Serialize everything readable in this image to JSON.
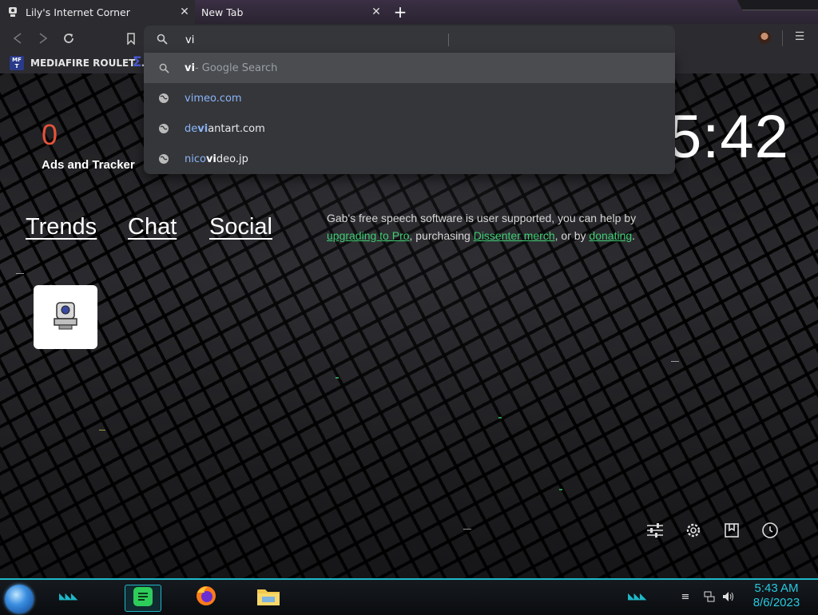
{
  "tabs": [
    {
      "title": "Lily's Internet Corner",
      "icon": "webcam-favicon-icon",
      "active": true
    },
    {
      "title": "New Tab",
      "active": false
    }
  ],
  "omnibox": {
    "value": "vi",
    "suggestions": [
      {
        "prefix": "vi",
        "rest": " - Google Search",
        "type": "search",
        "selected": true
      },
      {
        "before": "",
        "match": "vi",
        "after": "meo.com",
        "type": "url"
      },
      {
        "before": "de",
        "match": "vi",
        "after": "antart.com",
        "type": "url"
      },
      {
        "before": "nico",
        "match": "vi",
        "after": "deo.jp",
        "type": "url"
      }
    ]
  },
  "bookmarks": [
    {
      "label": "MEDIAFIRE ROULET...",
      "icon_text": "MF T"
    }
  ],
  "page": {
    "ads_count": "0",
    "ads_label": "Ads and Tracker",
    "clock": "5:42",
    "nav": [
      "Trends",
      "Chat",
      "Social"
    ],
    "gab": {
      "t1": "Gab's free speech software is user supported, you can help by ",
      "link1": "upgrading to Pro",
      "t2": ", purchasing ",
      "link2": "Dissenter merch",
      "t3": ", or by ",
      "link3": "donating",
      "t4": "."
    }
  },
  "taskbar": {
    "time": "5:43 AM",
    "date": "8/6/2023"
  },
  "colors": {
    "accent": "#1fb8c9",
    "ads_count": "#e7533a",
    "link_green": "#3fcf74",
    "omnibox_match": "#8ab4f8"
  }
}
